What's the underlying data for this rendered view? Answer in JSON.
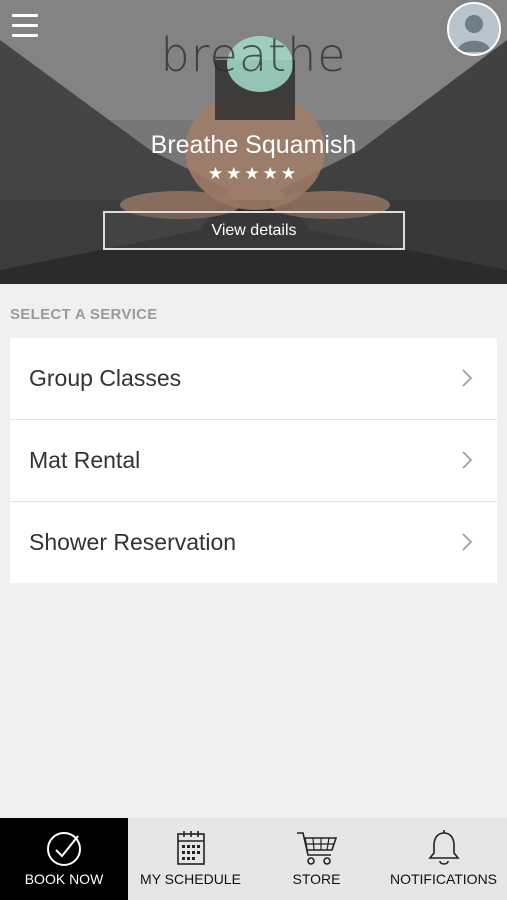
{
  "header": {
    "menu_icon": "hamburger-menu-icon",
    "avatar_icon": "user-avatar-icon",
    "logo_text": "breathe",
    "studio_name": "Breathe Squamish",
    "rating_stars": "★★★★★",
    "rating": 5,
    "view_details_label": "View details"
  },
  "services": {
    "section_label": "SELECT A SERVICE",
    "items": [
      {
        "label": "Group Classes"
      },
      {
        "label": "Mat Rental"
      },
      {
        "label": "Shower Reservation"
      }
    ]
  },
  "tabbar": {
    "tabs": [
      {
        "label": "BOOK NOW",
        "icon": "check-circle-icon",
        "active": true
      },
      {
        "label": "MY SCHEDULE",
        "icon": "calendar-icon",
        "active": false
      },
      {
        "label": "STORE",
        "icon": "shopping-cart-icon",
        "active": false
      },
      {
        "label": "NOTIFICATIONS",
        "icon": "bell-icon",
        "active": false
      }
    ]
  },
  "colors": {
    "active_tab_bg": "#000000",
    "tabbar_bg": "#e6e6e6",
    "page_bg": "#f0f0f0",
    "logo_accent": "#a5dccd"
  }
}
